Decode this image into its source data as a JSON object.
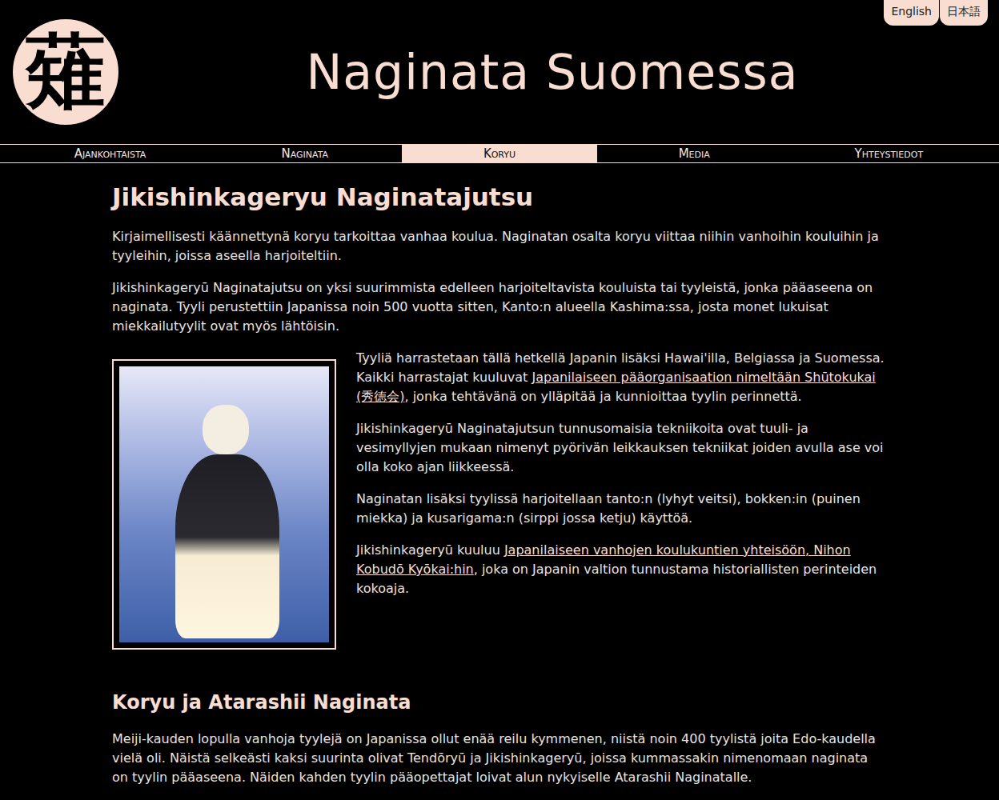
{
  "logo": {
    "glyph": "薙"
  },
  "site_title": "Naginata Suomessa",
  "languages": [
    {
      "label": "English"
    },
    {
      "label": "日本語"
    }
  ],
  "nav": [
    {
      "label": "Ajankohtaista",
      "selected": false
    },
    {
      "label": "Naginata",
      "selected": false
    },
    {
      "label": "Koryu",
      "selected": true
    },
    {
      "label": "Media",
      "selected": false
    },
    {
      "label": "Yhteystiedot",
      "selected": false
    }
  ],
  "article": {
    "title": "Jikishinkageryu Naginatajutsu",
    "intro": [
      [
        {
          "text": "Kirjaimellisesti käännettynä koryu tarkoittaa vanhaa koulua. Naginatan osalta koryu viittaa niihin vanhoihin kouluihin ja tyyleihin, joissa aseella harjoiteltiin.",
          "link": false
        }
      ],
      [
        {
          "text": "Jikishinkageryū Naginatajutsu on yksi suurimmista edelleen harjoiteltavista kouluista tai tyyleistä, jonka pääaseena on naginata. Tyyli perustettiin Japanissa noin 500 vuotta sitten, Kanto:n alueella Kashima:ssa, josta monet lukuisat miekkailutyylit ovat myös lähtöisin.",
          "link": false
        }
      ]
    ],
    "body": [
      [
        {
          "text": "Tyyliä harrastetaan tällä hetkellä Japanin lisäksi Hawai'illa, Belgiassa ja Suomessa. Kaikki harrastajat kuuluvat ",
          "link": false
        },
        {
          "text": "Japanilaiseen pääorganisaation nimeltään Shūtokukai (秀徳会)",
          "link": true
        },
        {
          "text": ", jonka tehtävänä on ylläpitää ja kunnioittaa tyylin perinnettä.",
          "link": false
        }
      ],
      [
        {
          "text": "Jikishinkageryū Naginatajutsun tunnusomaisia tekniikoita ovat tuuli- ja vesimyllyjen mukaan nimenyt pyörivän leikkauksen tekniikat joiden avulla ase voi olla koko ajan liikkeessä.",
          "link": false
        }
      ],
      [
        {
          "text": "Naginatan lisäksi tyylissä harjoitellaan tanto:n (lyhyt veitsi), bokken:in (puinen miekka) ja kusarigama:n (sirppi jossa ketju) käyttöä.",
          "link": false
        }
      ],
      [
        {
          "text": "Jikishinkageryū kuuluu ",
          "link": false
        },
        {
          "text": "Japanilaiseen vanhojen koulukuntien yhteisöön, Nihon Kobudō Kyōkai:hin",
          "link": true
        },
        {
          "text": ", joka on Japanin valtion tunnustama historiallisten perinteiden kokoaja.",
          "link": false
        }
      ]
    ]
  },
  "section": {
    "title": "Koryu ja Atarashii Naginata",
    "paragraphs": [
      [
        {
          "text": "Meiji-kauden lopulla vanhoja tyylejä on Japanissa ollut enää reilu kymmenen, niistä noin 400 tyylistä joita Edo-kaudella vielä oli. Näistä selkeästi kaksi suurinta olivat Tendōryū ja Jikishinkageryū, joissa kummassakin nimenomaan naginata on tyylin pääaseena. Näiden kahden tyylin pääopettajat loivat alun nykyiselle Atarashii Naginatalle.",
          "link": false
        }
      ]
    ]
  }
}
